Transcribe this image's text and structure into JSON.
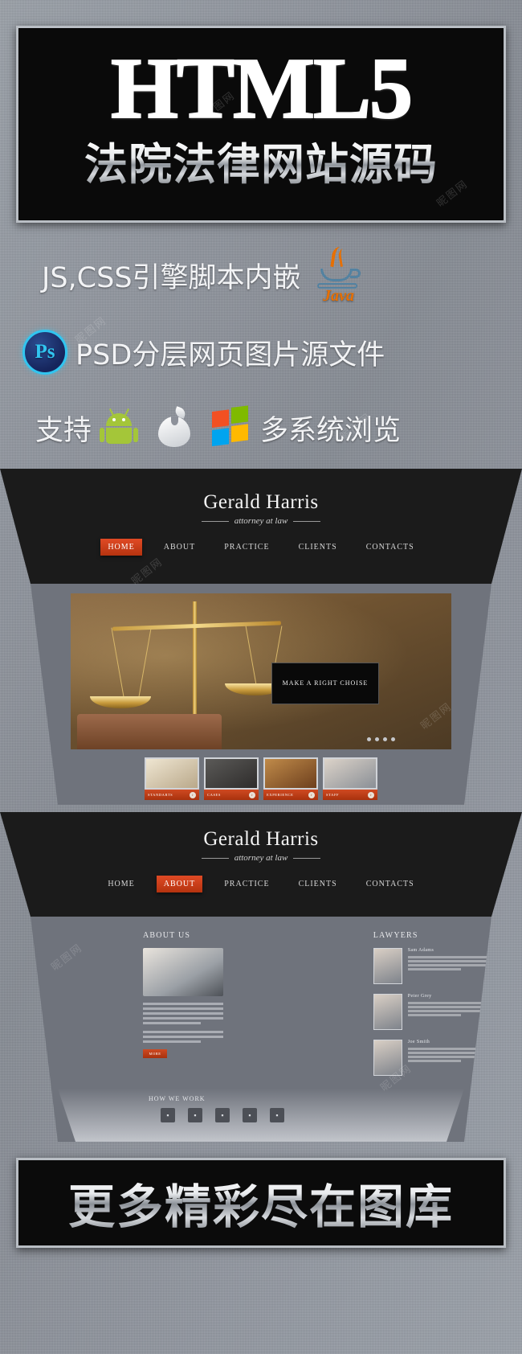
{
  "top_banner": {
    "title": "HTML5",
    "subtitle": "法院法律网站源码"
  },
  "features": [
    {
      "text": "JS,CSS引擎脚本内嵌",
      "icon": "java-icon",
      "icon_label": "Java"
    },
    {
      "text": "PSD分层网页图片源文件",
      "icon": "photoshop-icon",
      "icon_label": "Ps"
    },
    {
      "text_before": "支持",
      "text_after": "多系统浏览",
      "icons": [
        "android-icon",
        "apple-icon",
        "windows-icon"
      ]
    }
  ],
  "mockup_home": {
    "brand": "Gerald Harris",
    "tagline": "attorney at law",
    "nav": [
      {
        "label": "HOME",
        "active": true
      },
      {
        "label": "ABOUT",
        "active": false
      },
      {
        "label": "PRACTICE",
        "active": false
      },
      {
        "label": "CLIENTS",
        "active": false
      },
      {
        "label": "CONTACTS",
        "active": false
      }
    ],
    "hero_caption": "MAKE A RIGHT CHOISE",
    "cards": [
      {
        "label": "STANDARTS",
        "arrow": "›"
      },
      {
        "label": "CASES",
        "arrow": "›"
      },
      {
        "label": "EXPERIENCE",
        "arrow": "›"
      },
      {
        "label": "STAFF",
        "arrow": "›"
      }
    ]
  },
  "mockup_about": {
    "brand": "Gerald Harris",
    "tagline": "attorney at law",
    "nav": [
      {
        "label": "HOME",
        "active": false
      },
      {
        "label": "ABOUT",
        "active": true
      },
      {
        "label": "PRACTICE",
        "active": false
      },
      {
        "label": "CLIENTS",
        "active": false
      },
      {
        "label": "CONTACTS",
        "active": false
      }
    ],
    "about_title": "ABOUT US",
    "lawyers_title": "LAWYERS",
    "more_label": "MORE",
    "lawyers": [
      {
        "name": "Sam Adams"
      },
      {
        "name": "Peter Grey"
      },
      {
        "name": "Joe Smith"
      }
    ],
    "how_we_work": "HOW WE WORK"
  },
  "bottom_banner": {
    "text": "更多精彩尽在图库"
  },
  "watermarks": [
    "昵图网",
    "昵图网",
    "昵图网",
    "昵图网",
    "昵图网",
    "昵图网",
    "昵图网",
    "昵图网"
  ],
  "colors": {
    "accent": "#c04020",
    "dark": "#1b1b1b",
    "panel": "#6f737c",
    "background": "#8d919a"
  }
}
